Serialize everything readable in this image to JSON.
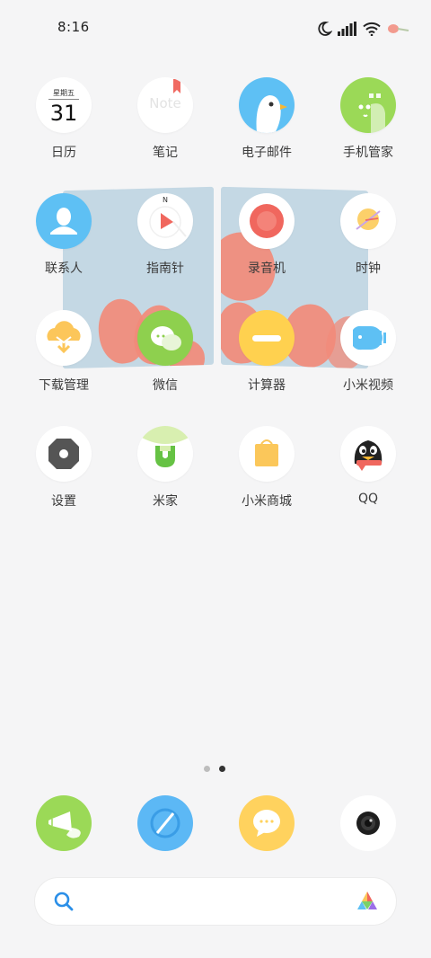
{
  "status_bar": {
    "time": "8:16",
    "icons": [
      "moon-icon",
      "signal-icon",
      "wifi-icon",
      "notification-icon"
    ]
  },
  "apps": [
    {
      "label": "日历",
      "icon": "calendar-icon",
      "calendar_weekday": "星期五",
      "calendar_day": "31"
    },
    {
      "label": "笔记",
      "icon": "notes-icon",
      "icon_text": "Note"
    },
    {
      "label": "电子邮件",
      "icon": "email-icon"
    },
    {
      "label": "手机管家",
      "icon": "security-icon"
    },
    {
      "label": "联系人",
      "icon": "contacts-icon"
    },
    {
      "label": "指南针",
      "icon": "compass-icon",
      "compass_north": "N"
    },
    {
      "label": "录音机",
      "icon": "recorder-icon"
    },
    {
      "label": "时钟",
      "icon": "clock-icon"
    },
    {
      "label": "下载管理",
      "icon": "download-icon"
    },
    {
      "label": "微信",
      "icon": "wechat-icon"
    },
    {
      "label": "计算器",
      "icon": "calculator-icon"
    },
    {
      "label": "小米视频",
      "icon": "video-icon"
    },
    {
      "label": "设置",
      "icon": "settings-icon"
    },
    {
      "label": "米家",
      "icon": "mijia-icon"
    },
    {
      "label": "小米商城",
      "icon": "mi-store-icon"
    },
    {
      "label": "QQ",
      "icon": "qq-icon"
    }
  ],
  "page_indicator": {
    "count": 2,
    "active_index": 1
  },
  "dock": [
    {
      "icon": "speaker-app-icon",
      "color": "#9bd957"
    },
    {
      "icon": "browser-icon",
      "color": "#5cb8f5"
    },
    {
      "icon": "messages-icon",
      "color": "#ffd25e"
    },
    {
      "icon": "camera-icon",
      "color": "#ffffff"
    }
  ],
  "search_bar": {
    "search_icon": "search-icon",
    "assistant_icon": "app-vault-icon"
  },
  "colors": {
    "background": "#f5f5f6",
    "wallpaper_panel": "#c4d8e4",
    "tulip": "#f18b7a"
  }
}
